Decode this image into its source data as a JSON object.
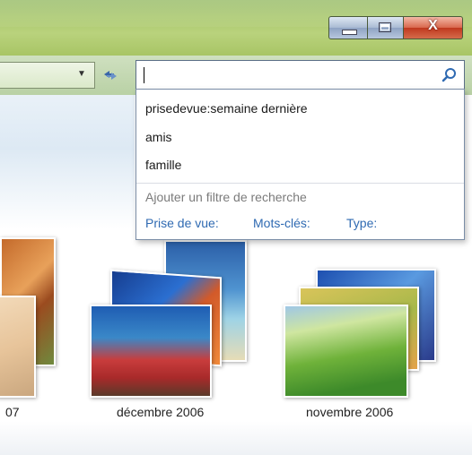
{
  "window": {
    "controls": {
      "minimize_icon": "minimize-icon",
      "maximize_icon": "maximize-icon",
      "close_label": "X"
    }
  },
  "toolbar": {
    "dropdown_icon": "chevron-down-icon",
    "refresh_icon": "refresh-icon"
  },
  "search": {
    "value": "",
    "icon": "search-icon",
    "suggestions": [
      "prisedevue:semaine dernière",
      "amis",
      "famille"
    ],
    "filter_hint": "Ajouter un filtre de recherche",
    "filters": [
      "Prise de vue:",
      "Mots-clés:",
      "Type:"
    ]
  },
  "gallery": {
    "captions": [
      "07",
      "décembre 2006",
      "novembre 2006"
    ]
  },
  "colors": {
    "accent": "#2f6ab2",
    "titlebar": "#a9c86e"
  }
}
